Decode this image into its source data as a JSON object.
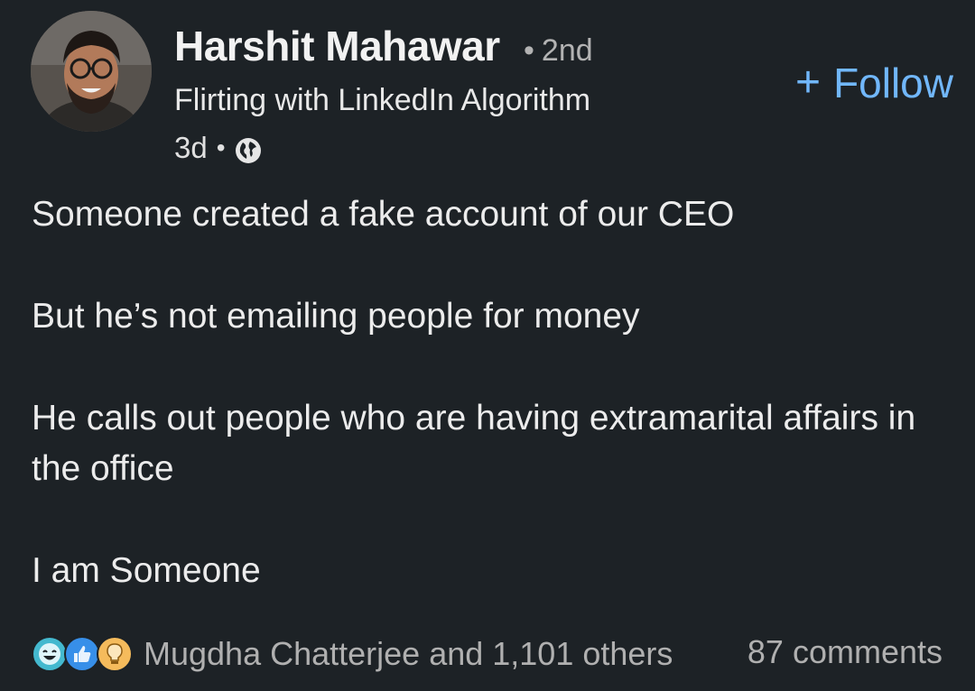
{
  "author": {
    "name": "Harshit Mahawar",
    "connection_degree": "2nd",
    "headline": "Flirting with LinkedIn Algorithm",
    "posted_ago": "3d",
    "visibility_icon": "globe-icon"
  },
  "follow_button": {
    "plus": "+",
    "label": "Follow"
  },
  "post": {
    "paragraphs": [
      "Someone created a fake account of our CEO",
      "But he’s not emailing people for money",
      "He calls out people who are having extramarital affairs in the office",
      "I am Someone"
    ]
  },
  "social": {
    "reactions": [
      "funny-reaction-icon",
      "like-reaction-icon",
      "insightful-reaction-icon"
    ],
    "reactions_text": "Mugdha Chatterjee and 1,101 others",
    "comments_text": "87 comments"
  },
  "colors": {
    "background": "#1d2226",
    "link_blue": "#71b7fb",
    "funny": "#44b9cf",
    "like": "#378fe9",
    "insightful": "#f5bb5c"
  }
}
